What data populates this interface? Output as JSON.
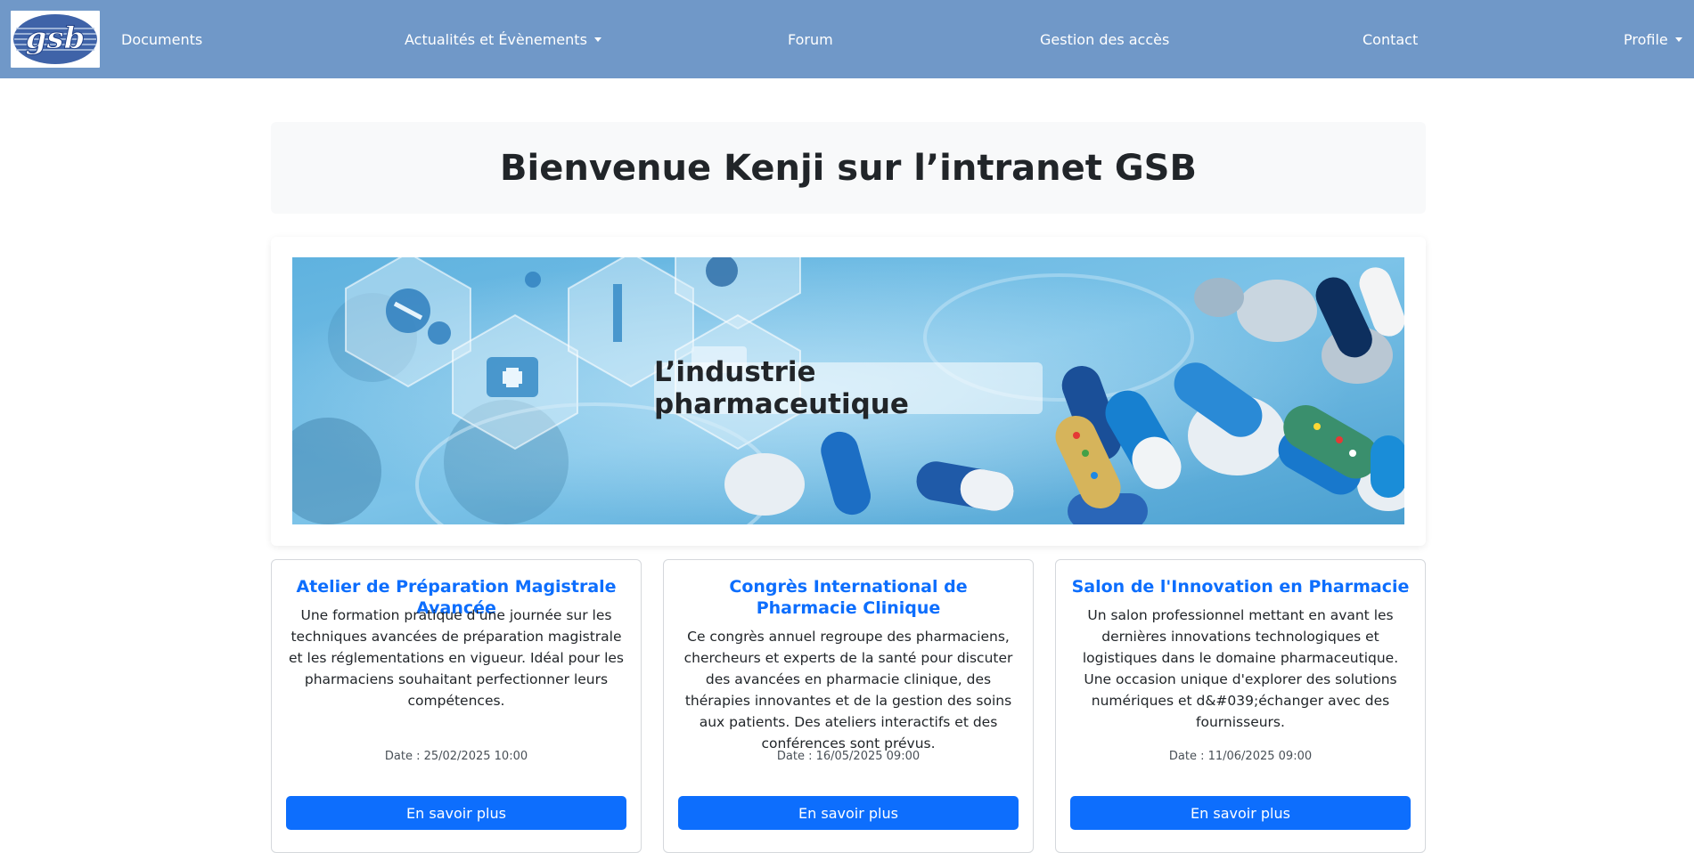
{
  "nav": {
    "logo_text": "gsb",
    "items": [
      {
        "label": "Documents"
      },
      {
        "label": "Actualités et Évènements"
      },
      {
        "label": "Forum"
      },
      {
        "label": "Gestion des accès"
      },
      {
        "label": "Contact"
      },
      {
        "label": "Profile"
      }
    ]
  },
  "hero": {
    "title": "Bienvenue Kenji sur l’intranet GSB"
  },
  "banner": {
    "caption": "L’industrie pharmaceutique"
  },
  "events": [
    {
      "title": "Atelier de Préparation Magistrale Avancée",
      "description": "Une formation pratique d'une journée sur les techniques avancées de préparation magistrale et les réglementations en vigueur. Idéal pour les pharmaciens souhaitant perfectionner leurs compétences.",
      "date": "Date : 25/02/2025 10:00",
      "button": "En savoir plus"
    },
    {
      "title": "Congrès International de Pharmacie Clinique",
      "description": "Ce congrès annuel regroupe des pharmaciens, chercheurs et experts de la santé pour discuter des avancées en pharmacie clinique, des thérapies innovantes et de la gestion des soins aux patients. Des ateliers interactifs et des conférences sont prévus.",
      "date": "Date : 16/05/2025 09:00",
      "button": "En savoir plus"
    },
    {
      "title": "Salon de l'Innovation en Pharmacie",
      "description": "Un salon professionnel mettant en avant les dernières innovations technologiques et logistiques dans le domaine pharmaceutique. Une occasion unique d'explorer des solutions numériques et d&#039;échanger avec des fournisseurs.",
      "date": "Date : 11/06/2025 09:00",
      "button": "En savoir plus"
    }
  ],
  "colors": {
    "navbar": "#7098c8",
    "primary": "#0d6efd",
    "hero_bg": "#f8f9fa"
  }
}
